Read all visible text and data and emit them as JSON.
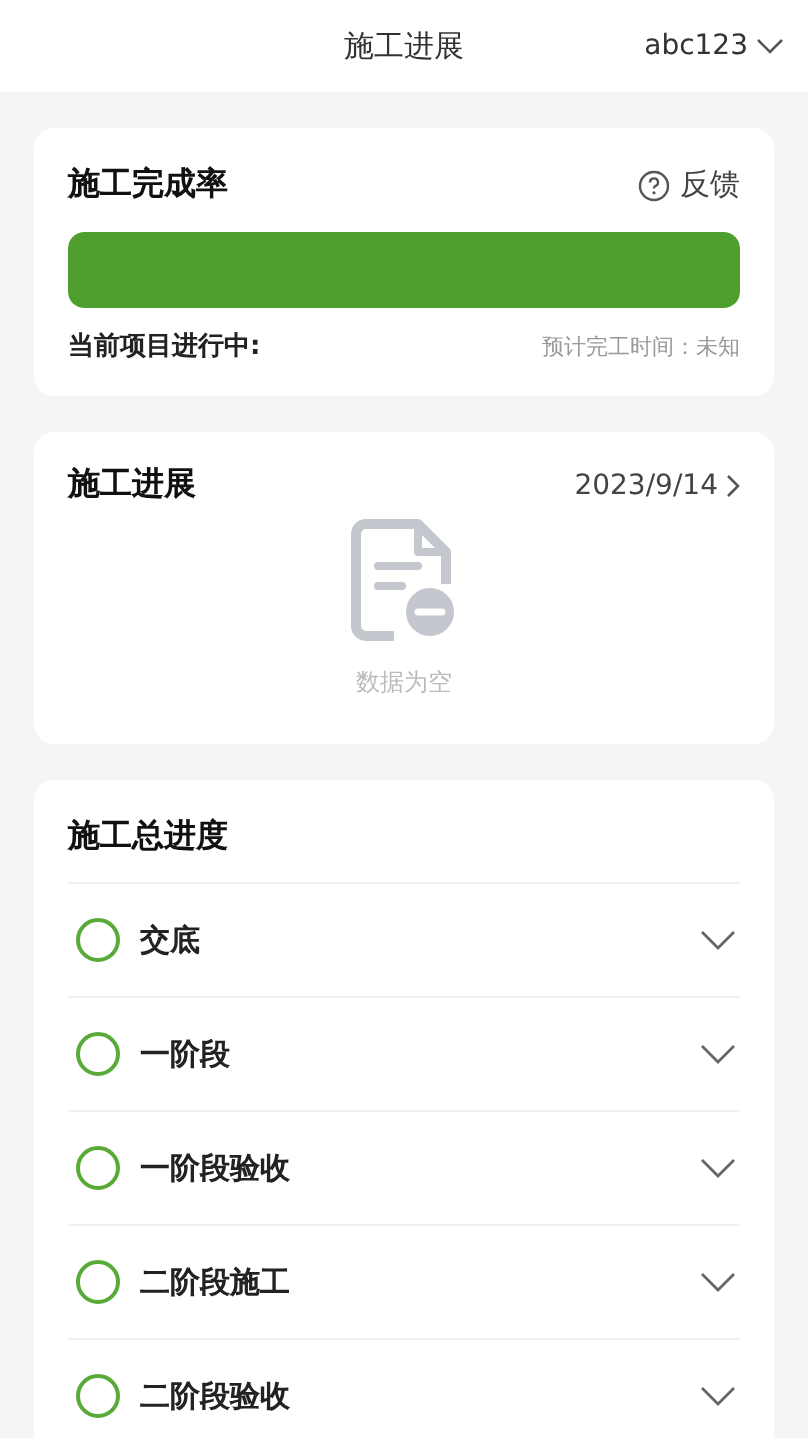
{
  "header": {
    "title": "施工进展",
    "account": "abc123"
  },
  "completion": {
    "title": "施工完成率",
    "feedback": "反馈",
    "level": 1,
    "status": "当前项目进行中:",
    "estimate": "预计完工时间：未知"
  },
  "progress": {
    "title": "施工进展",
    "date": "2023/9/14",
    "empty_text": "数据为空"
  },
  "overall": {
    "title": "施工总进度",
    "steps": [
      {
        "label": "交底",
        "done": false,
        "expanded": false
      },
      {
        "label": "一阶段",
        "done": false,
        "expanded": false
      },
      {
        "label": "一阶段验收",
        "done": false,
        "expanded": false
      },
      {
        "label": "二阶段施工",
        "done": false,
        "expanded": false
      },
      {
        "label": "二阶段验收",
        "done": false,
        "expanded": false
      }
    ]
  }
}
